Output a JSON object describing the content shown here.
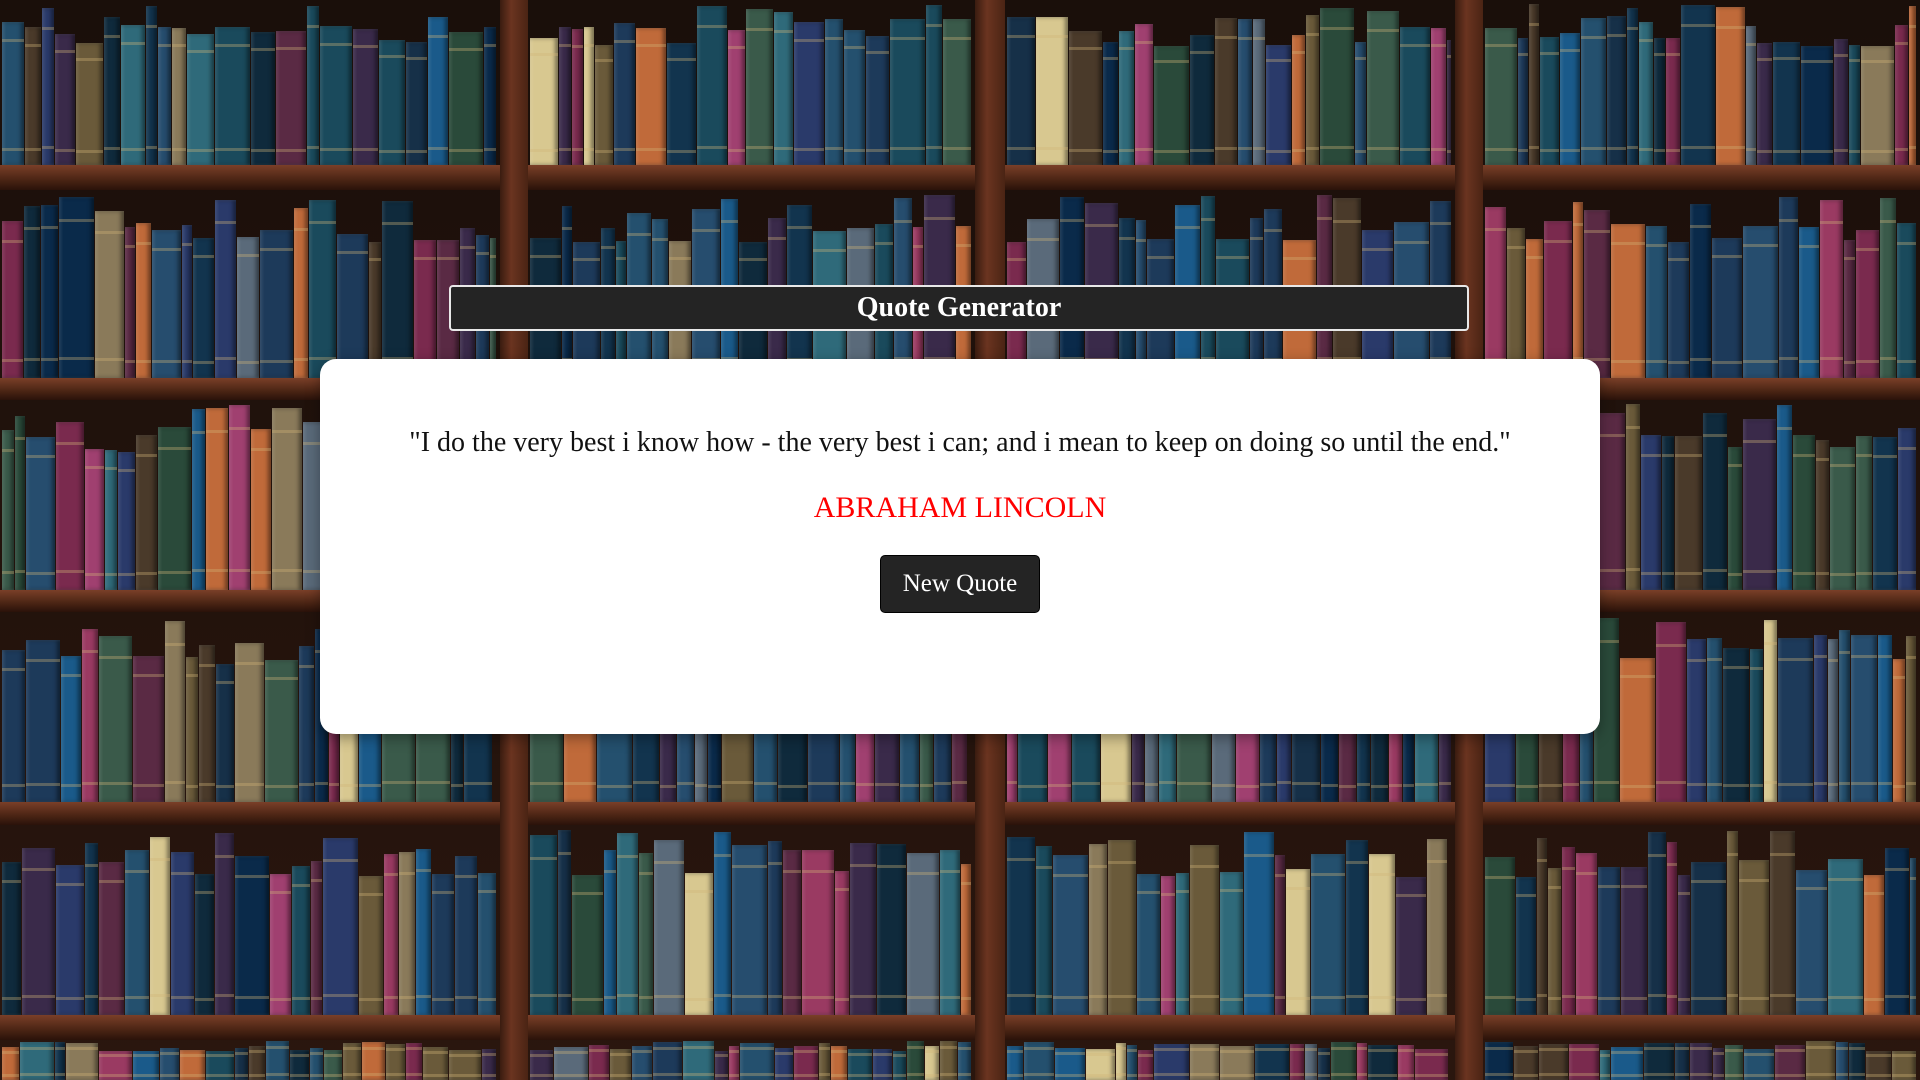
{
  "header": {
    "title": "Quote Generator"
  },
  "quote": {
    "text": "\"I do the very best i know how - the very best i can; and i mean to keep on doing so until the end.\"",
    "author": "ABRAHAM LINCOLN"
  },
  "actions": {
    "new_quote_label": "New Quote"
  },
  "colors": {
    "header_bg": "#242424",
    "card_bg": "#ffffff",
    "author": "#ff0000",
    "button_bg": "#242424",
    "button_text": "#ffffff"
  }
}
